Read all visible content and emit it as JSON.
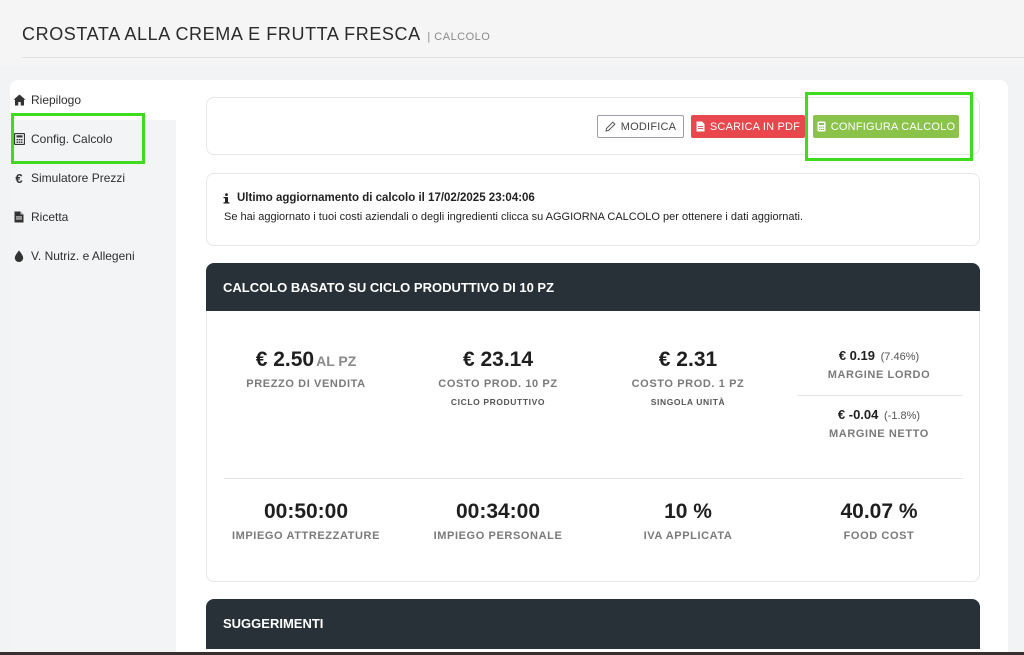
{
  "page": {
    "title": "CROSTATA ALLA CREMA E FRUTTA FRESCA",
    "subtitle": "| CALCOLO"
  },
  "sidebar": {
    "items": [
      {
        "label": "Riepilogo",
        "icon": "home-icon"
      },
      {
        "label": "Config. Calcolo",
        "icon": "calculator-icon"
      },
      {
        "label": "Simulatore Prezzi",
        "icon": "euro-icon"
      },
      {
        "label": "Ricetta",
        "icon": "document-icon"
      },
      {
        "label": "V. Nutriz. e Allegeni",
        "icon": "drop-icon"
      }
    ]
  },
  "toolbar": {
    "modify_label": "MODIFICA",
    "pdf_label": "SCARICA IN PDF",
    "configure_label": "CONFIGURA CALCOLO"
  },
  "update": {
    "title": "Ultimo aggiornamento di calcolo il 17/02/2025 23:04:06",
    "text": "Se hai aggiornato i tuoi costi aziendali o degli ingredienti clicca su AGGIORNA CALCOLO per ottenere i dati aggiornati."
  },
  "calc": {
    "header": "CALCOLO BASATO SU CICLO PRODUTTIVO DI 10 PZ",
    "price": {
      "value": "€ 2.50",
      "unit": "AL PZ",
      "label": "PREZZO DI VENDITA"
    },
    "cost_cycle": {
      "value": "€ 23.14",
      "label": "COSTO PROD. 10 PZ",
      "sublabel": "CICLO PRODUTTIVO"
    },
    "cost_unit": {
      "value": "€ 2.31",
      "label": "COSTO PROD. 1 PZ",
      "sublabel": "SINGOLA UNITÀ"
    },
    "gross_margin": {
      "value": "€ 0.19",
      "pct": "(7.46%)",
      "label": "MARGINE LORDO"
    },
    "net_margin": {
      "value": "€ -0.04",
      "pct": "(-1.8%)",
      "label": "MARGINE NETTO"
    },
    "equipment_time": {
      "value": "00:50:00",
      "label": "IMPIEGO ATTREZZATURE"
    },
    "staff_time": {
      "value": "00:34:00",
      "label": "IMPIEGO PERSONALE"
    },
    "vat": {
      "value": "10 %",
      "label": "IVA APPLICATA"
    },
    "food_cost": {
      "value": "40.07 %",
      "label": "FOOD COST"
    }
  },
  "suggestions": {
    "header": "SUGGERIMENTI"
  },
  "colors": {
    "dark_header": "#283038",
    "pdf_button": "#e8484d",
    "configure_button": "#8bc34a",
    "highlight": "#3fdb1f"
  }
}
